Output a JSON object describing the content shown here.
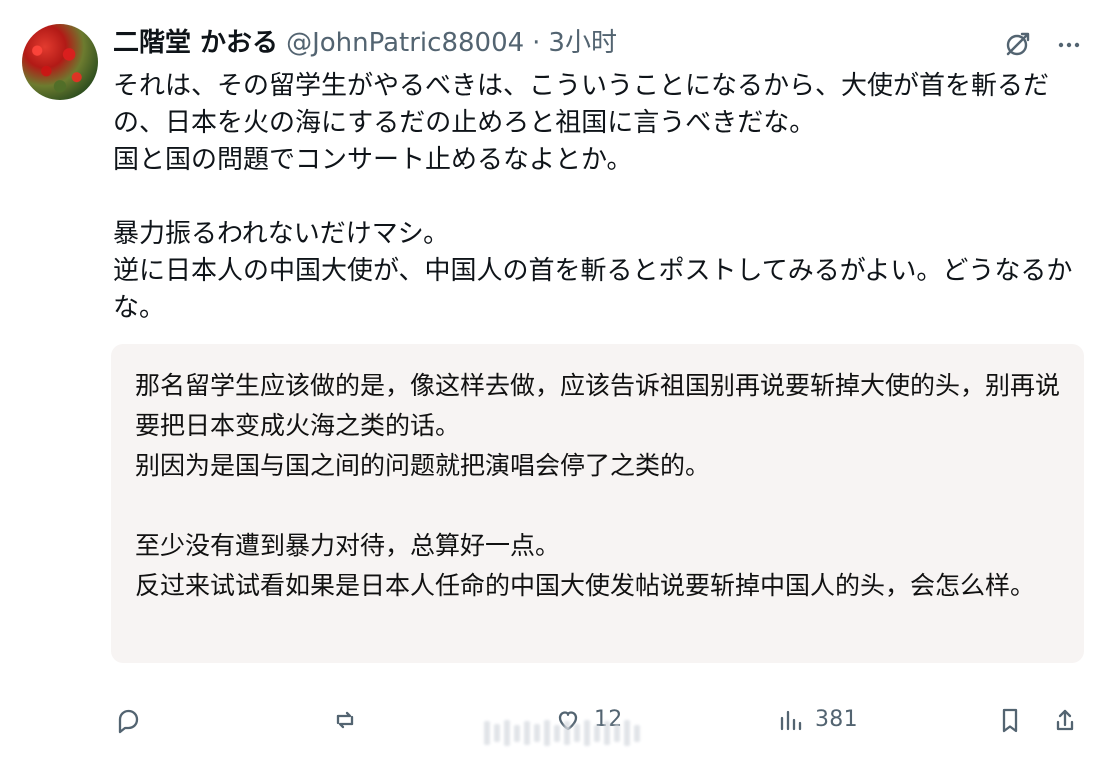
{
  "post": {
    "author": {
      "display_name": "二階堂 かおる",
      "handle": "@JohnPatric88004",
      "time": "3小时"
    },
    "original_text": {
      "line1": "それは、その留学生がやるべきは、こういうことになるから、大使が首を斬るだの、日本を火の海にするだの止めろと祖国に言うべきだな。",
      "line2": "国と国の問題でコンサート止めるなよとか。",
      "line3": "暴力振るわれないだけマシ。",
      "line4": "逆に日本人の中国大使が、中国人の首を斬るとポストしてみるがよい。どうなるかな。"
    },
    "translation_text": {
      "line1": "那名留学生应该做的是，像这样去做，应该告诉祖国别再说要斩掉大使的头，别再说要把日本变成火海之类的话。",
      "line2": "别因为是国与国之间的问题就把演唱会停了之类的。",
      "line3": "至少没有遭到暴力对待，总算好一点。",
      "line4": "反过来试试看如果是日本人任命的中国大使发帖说要斩掉中国人的头，会怎么样。"
    },
    "stats": {
      "like_count": "12",
      "views_count": "381"
    }
  },
  "icons": {
    "header": [
      "grok-icon",
      "more-options-icon"
    ],
    "actions": [
      "reply-icon",
      "repost-icon",
      "like-icon",
      "views-icon",
      "bookmark-icon",
      "share-icon"
    ]
  },
  "colors": {
    "text_primary": "#0f1419",
    "text_secondary": "#536471",
    "translation_bg": "#f7f4f3"
  }
}
